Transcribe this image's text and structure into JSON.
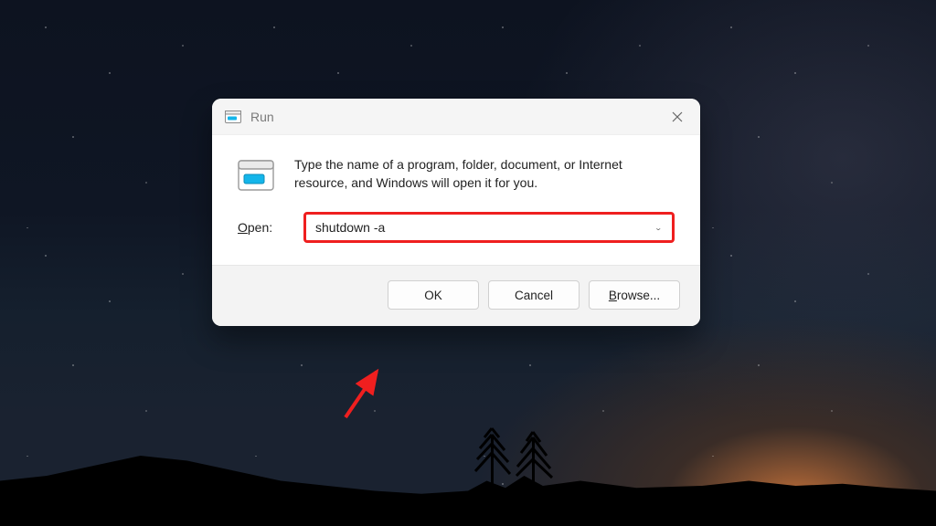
{
  "dialog": {
    "title": "Run",
    "description": "Type the name of a program, folder, document, or Internet resource, and Windows will open it for you.",
    "open_label_prefix": "O",
    "open_label_rest": "pen:",
    "command_value": "shutdown -a",
    "buttons": {
      "ok": "OK",
      "cancel": "Cancel",
      "browse_prefix": "B",
      "browse_rest": "rowse..."
    }
  },
  "annotation": {
    "highlight_color": "#ef1f1f",
    "arrow_color": "#ef1f1f"
  }
}
